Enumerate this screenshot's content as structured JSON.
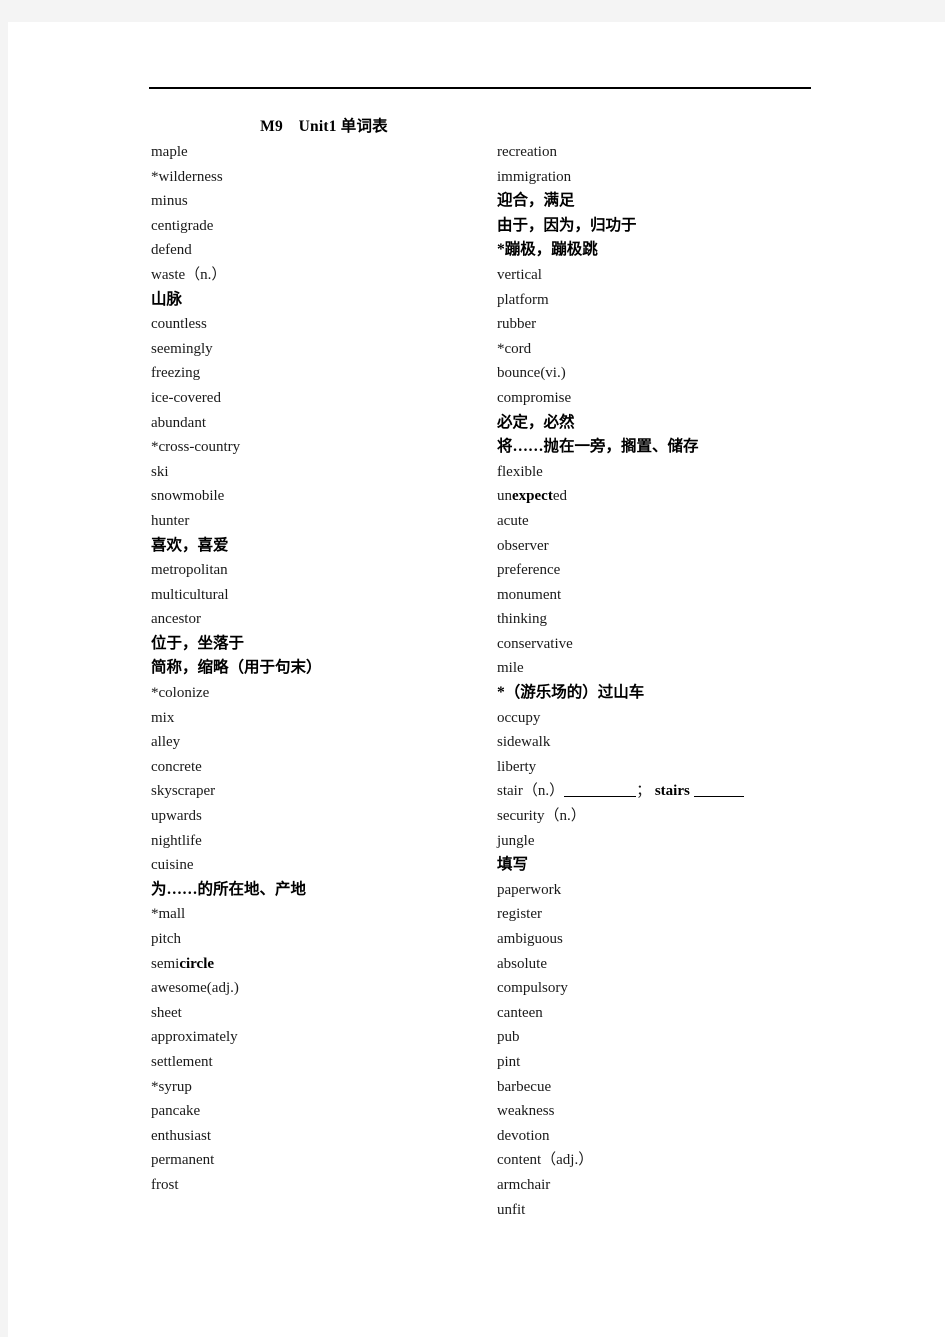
{
  "document": {
    "title": "M9　Unit1 单词表"
  },
  "columns": {
    "left": [
      {
        "text": "maple",
        "cn": false
      },
      {
        "text": "*wilderness",
        "cn": false
      },
      {
        "text": "minus",
        "cn": false
      },
      {
        "text": "centigrade",
        "cn": false
      },
      {
        "text": "defend",
        "cn": false
      },
      {
        "text": "waste（n.）",
        "cn": false
      },
      {
        "text": "山脉",
        "cn": true
      },
      {
        "text": "countless",
        "cn": false
      },
      {
        "text": "seemingly",
        "cn": false
      },
      {
        "text": "freezing",
        "cn": false
      },
      {
        "text": "ice-covered",
        "cn": false
      },
      {
        "text": "abundant",
        "cn": false
      },
      {
        "text": "*cross-country",
        "cn": false
      },
      {
        "text": "ski",
        "cn": false
      },
      {
        "text": "snowmobile",
        "cn": false
      },
      {
        "text": "hunter",
        "cn": false
      },
      {
        "text": "喜欢，喜爱",
        "cn": true
      },
      {
        "text": "metropolitan",
        "cn": false
      },
      {
        "text": "multicultural",
        "cn": false
      },
      {
        "text": "ancestor",
        "cn": false
      },
      {
        "text": "位于，坐落于",
        "cn": true
      },
      {
        "text": "简称，缩略（用于句末）",
        "cn": true
      },
      {
        "text": "*colonize",
        "cn": false
      },
      {
        "text": "mix",
        "cn": false
      },
      {
        "text": "alley",
        "cn": false
      },
      {
        "text": "concrete",
        "cn": false
      },
      {
        "text": "skyscraper",
        "cn": false
      },
      {
        "text": "upwards",
        "cn": false
      },
      {
        "text": "nightlife",
        "cn": false
      },
      {
        "text": "cuisine",
        "cn": false
      },
      {
        "text": "为……的所在地、产地",
        "cn": true
      },
      {
        "text": "*mall",
        "cn": false
      },
      {
        "text": "pitch",
        "cn": false
      },
      {
        "text": "semicircle",
        "cn": false,
        "html": "semi<b>circle</b>"
      },
      {
        "text": "awesome(adj.)",
        "cn": false
      },
      {
        "text": "sheet",
        "cn": false
      },
      {
        "text": "approximately",
        "cn": false
      },
      {
        "text": "settlement",
        "cn": false
      },
      {
        "text": "*syrup",
        "cn": false
      },
      {
        "text": "pancake",
        "cn": false
      },
      {
        "text": "enthusiast",
        "cn": false
      },
      {
        "text": "permanent",
        "cn": false
      },
      {
        "text": "frost",
        "cn": false
      }
    ],
    "right": [
      {
        "text": "recreation",
        "cn": false
      },
      {
        "text": "immigration",
        "cn": false
      },
      {
        "text": "迎合，满足",
        "cn": true
      },
      {
        "text": "由于，因为，归功于",
        "cn": true
      },
      {
        "text": "*蹦极，蹦极跳",
        "cn": true
      },
      {
        "text": "vertical",
        "cn": false
      },
      {
        "text": "platform",
        "cn": false
      },
      {
        "text": "rubber",
        "cn": false
      },
      {
        "text": "*cord",
        "cn": false
      },
      {
        "text": "bounce(vi.)",
        "cn": false
      },
      {
        "text": "compromise",
        "cn": false
      },
      {
        "text": "必定，必然",
        "cn": true
      },
      {
        "text": "将……抛在一旁，搁置、储存",
        "cn": true
      },
      {
        "text": "flexible",
        "cn": false
      },
      {
        "text": "unexpected",
        "cn": false,
        "html": "un<b>expect</b>ed"
      },
      {
        "text": "acute",
        "cn": false
      },
      {
        "text": "observer",
        "cn": false
      },
      {
        "text": "preference",
        "cn": false
      },
      {
        "text": "monument",
        "cn": false
      },
      {
        "text": "thinking",
        "cn": false
      },
      {
        "text": "conservative",
        "cn": false
      },
      {
        "text": "mile",
        "cn": false
      },
      {
        "text": "*（游乐场的）过山车",
        "cn": true
      },
      {
        "text": "occupy",
        "cn": false
      },
      {
        "text": "sidewalk",
        "cn": false
      },
      {
        "text": "liberty",
        "cn": false
      },
      {
        "text": "stair（n.）______； stairs _____",
        "cn": false,
        "html": "stair（n.）<span class=\"blank-long\"></span>； <b>stairs</b> <span class=\"blank-short\"></span>"
      },
      {
        "text": "security（n.）",
        "cn": false
      },
      {
        "text": "jungle",
        "cn": false
      },
      {
        "text": "填写",
        "cn": true
      },
      {
        "text": "paperwork",
        "cn": false
      },
      {
        "text": "register",
        "cn": false
      },
      {
        "text": "ambiguous",
        "cn": false
      },
      {
        "text": "absolute",
        "cn": false
      },
      {
        "text": "compulsory",
        "cn": false
      },
      {
        "text": "canteen",
        "cn": false
      },
      {
        "text": "pub",
        "cn": false
      },
      {
        "text": "pint",
        "cn": false
      },
      {
        "text": "barbecue",
        "cn": false
      },
      {
        "text": "weakness",
        "cn": false
      },
      {
        "text": "devotion",
        "cn": false
      },
      {
        "text": "content（adj.）",
        "cn": false
      },
      {
        "text": "armchair",
        "cn": false
      },
      {
        "text": "unfit",
        "cn": false
      }
    ]
  }
}
